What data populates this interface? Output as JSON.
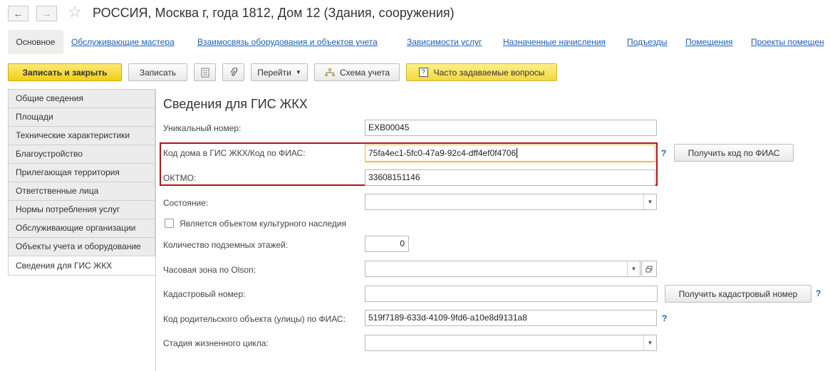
{
  "window": {
    "title": "РОССИЯ, Москва г, года 1812, Дом 12 (Здания, сооружения)"
  },
  "icons": {
    "back": "arrow-left-icon",
    "forward": "arrow-right-icon",
    "favorite": "star-icon"
  },
  "tabs": [
    {
      "label": "Основное",
      "active": true
    },
    {
      "label": "Обслуживающие мастера"
    },
    {
      "label": "Взаимосвязь оборудования и объектов учета"
    },
    {
      "label": "Зависимости услуг"
    },
    {
      "label": "Назначенные начисления"
    },
    {
      "label": "Подъезды"
    },
    {
      "label": "Помещения"
    },
    {
      "label": "Проекты помещен"
    }
  ],
  "toolbar": {
    "save_close": "Записать и закрыть",
    "save": "Записать",
    "goto": "Перейти",
    "scheme": "Схема учета",
    "faq": "Часто задаваемые вопросы"
  },
  "sidebar": {
    "items": [
      {
        "label": "Общие сведения"
      },
      {
        "label": "Площади"
      },
      {
        "label": "Технические характеристики"
      },
      {
        "label": "Благоустройство"
      },
      {
        "label": "Прилегающая территория"
      },
      {
        "label": "Ответственные лица"
      },
      {
        "label": "Нормы потребления услуг"
      },
      {
        "label": "Обслуживающие организации"
      },
      {
        "label": "Объекты учета и оборудование"
      },
      {
        "label": "Сведения для ГИС ЖКХ",
        "active": true
      }
    ]
  },
  "form": {
    "title": "Сведения для ГИС ЖКХ",
    "unique_number_label": "Уникальный номер:",
    "unique_number_value": "EXB00045",
    "house_code_label": "Код дома в ГИС ЖКХ/Код по ФИАС:",
    "house_code_value": "75fa4ec1-5fc0-47a9-92c4-dff4ef0f4706",
    "get_fias_button": "Получить код по ФИАС",
    "oktmo_label": "ОКТМО:",
    "oktmo_value": "33608151146",
    "state_label": "Состояние:",
    "state_value": "",
    "cultural_heritage_label": "Является объектом культурного наследия",
    "cultural_heritage_checked": false,
    "underground_floors_label": "Количество подземных этажей:",
    "underground_floors_value": "0",
    "timezone_label": "Часовая зона по Olson:",
    "timezone_value": "",
    "cadastral_label": "Кадастровый номер:",
    "cadastral_value": "",
    "get_cadastral_button": "Получить кадастровый номер",
    "parent_code_label": "Код родительского объекта (улицы) по ФИАС:",
    "parent_code_value": "519f7189-633d-4109-9fd6-a10e8d9131a8",
    "lifecycle_label": "Стадия жизненного цикла:",
    "lifecycle_value": "",
    "help": "?"
  },
  "colors": {
    "link": "#1c60b3",
    "highlight_frame": "#b0141a",
    "primary_button": "#f1cf13"
  }
}
